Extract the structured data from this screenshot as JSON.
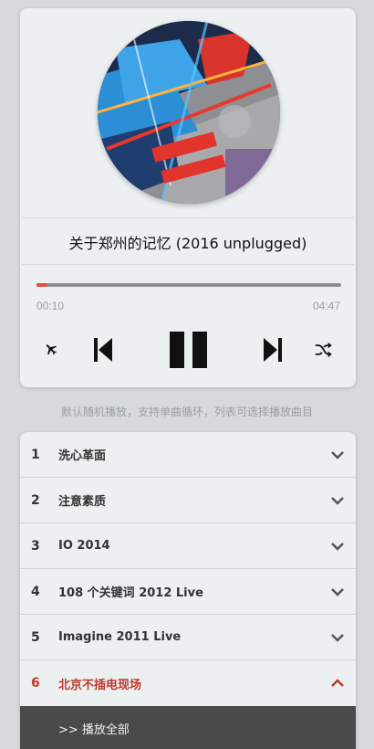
{
  "player": {
    "song_title": "关于郑州的记忆 (2016 unplugged)",
    "time_current": "00:10",
    "time_total": "04:47",
    "progress_fraction": 0.036,
    "accent_color": "#e74c3c",
    "controls": {
      "mode": "airplane-icon",
      "prev": "skip-previous-icon",
      "play_pause": "pause-icon",
      "next": "skip-next-icon",
      "shuffle": "shuffle-icon"
    }
  },
  "hint": "默认随机播放，支持单曲循环，列表可选择播放曲目",
  "playlist": {
    "items": [
      {
        "num": "1",
        "name": "洗心革面",
        "expanded": false
      },
      {
        "num": "2",
        "name": "注意素质",
        "expanded": false
      },
      {
        "num": "3",
        "name": "IO 2014",
        "expanded": false
      },
      {
        "num": "4",
        "name": "108 个关键词 2012 Live",
        "expanded": false
      },
      {
        "num": "5",
        "name": "Imagine 2011 Live",
        "expanded": false
      },
      {
        "num": "6",
        "name": "北京不插电现场",
        "expanded": true
      }
    ],
    "play_all_label": ">> 播放全部",
    "active_color": "#c0392b"
  }
}
